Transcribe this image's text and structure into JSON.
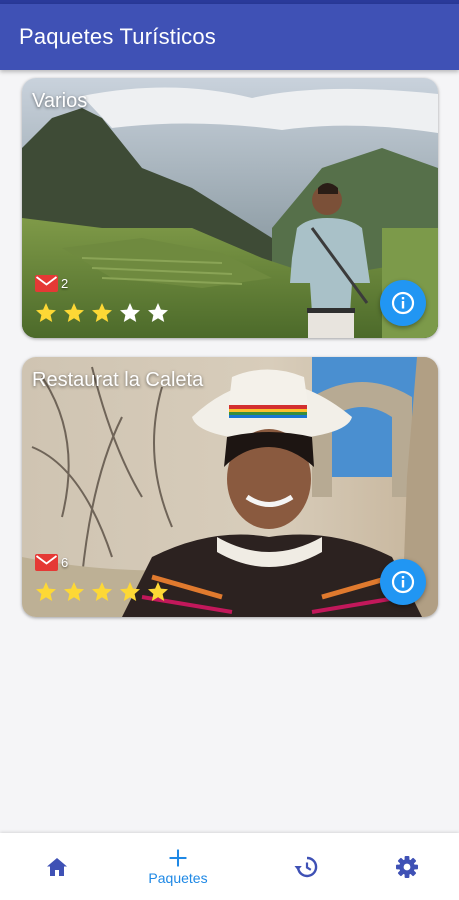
{
  "app_bar": {
    "title": "Paquetes Turísticos",
    "color": "#3f51b5"
  },
  "packages": [
    {
      "title": "Varios",
      "messages": "2",
      "rating": 3,
      "max_rating": 5,
      "mail_icon": "mail-icon",
      "info_icon": "info-icon"
    },
    {
      "title": "Restaurat la Caleta",
      "messages": "6",
      "rating": 5,
      "max_rating": 5,
      "mail_icon": "mail-icon",
      "info_icon": "info-icon"
    }
  ],
  "bottom_nav": {
    "items": [
      {
        "icon": "home-icon",
        "label": "",
        "active": false
      },
      {
        "icon": "plus-icon",
        "label": "Paquetes",
        "active": true
      },
      {
        "icon": "history-icon",
        "label": "",
        "active": false
      },
      {
        "icon": "gear-icon",
        "label": "",
        "active": false
      }
    ]
  },
  "colors": {
    "accent": "#2196f3",
    "star_filled": "#fdd835",
    "star_empty": "#ffffff",
    "mail": "#e53935",
    "nav_icon": "#3f51b5",
    "nav_active": "#1e88e5"
  }
}
